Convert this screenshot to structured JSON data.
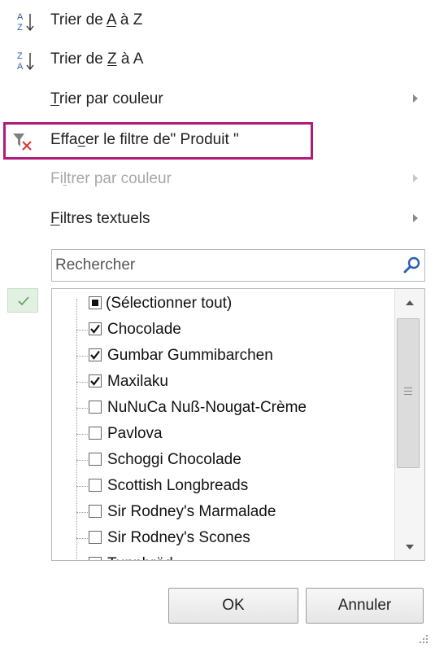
{
  "menu": {
    "sort_az": {
      "prefix": "Trier de ",
      "key": "A",
      "suffix": " à Z",
      "icon": "sort-ascending-icon"
    },
    "sort_za": {
      "prefix": "Trier de ",
      "key": "Z",
      "suffix": " à A",
      "icon": "sort-descending-icon"
    },
    "sort_color": {
      "key": "T",
      "rest": "rier par couleur"
    },
    "clear_filter": {
      "before": "Effa",
      "key": "c",
      "after": "er le filtre de\" Produit \"",
      "icon": "clear-filter-icon"
    },
    "filter_color": {
      "before": "Fi",
      "key": "l",
      "after": "trer par couleur",
      "disabled": true
    },
    "text_filters": {
      "key": "F",
      "rest": "iltres textuels"
    }
  },
  "search": {
    "placeholder": "Rechercher",
    "value": "",
    "icon": "search-icon"
  },
  "list": {
    "items": [
      {
        "label": "(Sélectionner tout)",
        "state": "partial"
      },
      {
        "label": "Chocolade",
        "state": "checked"
      },
      {
        "label": "Gumbar Gummibarchen",
        "state": "checked"
      },
      {
        "label": "Maxilaku",
        "state": "checked"
      },
      {
        "label": "NuNuCa Nuß-Nougat-Crème",
        "state": "unchecked"
      },
      {
        "label": "Pavlova",
        "state": "unchecked"
      },
      {
        "label": "Schoggi Chocolade",
        "state": "unchecked"
      },
      {
        "label": "Scottish Longbreads",
        "state": "unchecked"
      },
      {
        "label": "Sir Rodney's Marmalade",
        "state": "unchecked"
      },
      {
        "label": "Sir Rodney's Scones",
        "state": "unchecked"
      },
      {
        "label": "Tunnbröd",
        "state": "unchecked"
      }
    ]
  },
  "buttons": {
    "ok": "OK",
    "cancel": "Annuler"
  },
  "colors": {
    "highlight": "#b2197b",
    "filter_icon_x": "#d9342b",
    "selection_tint": "#e1f0e1"
  }
}
